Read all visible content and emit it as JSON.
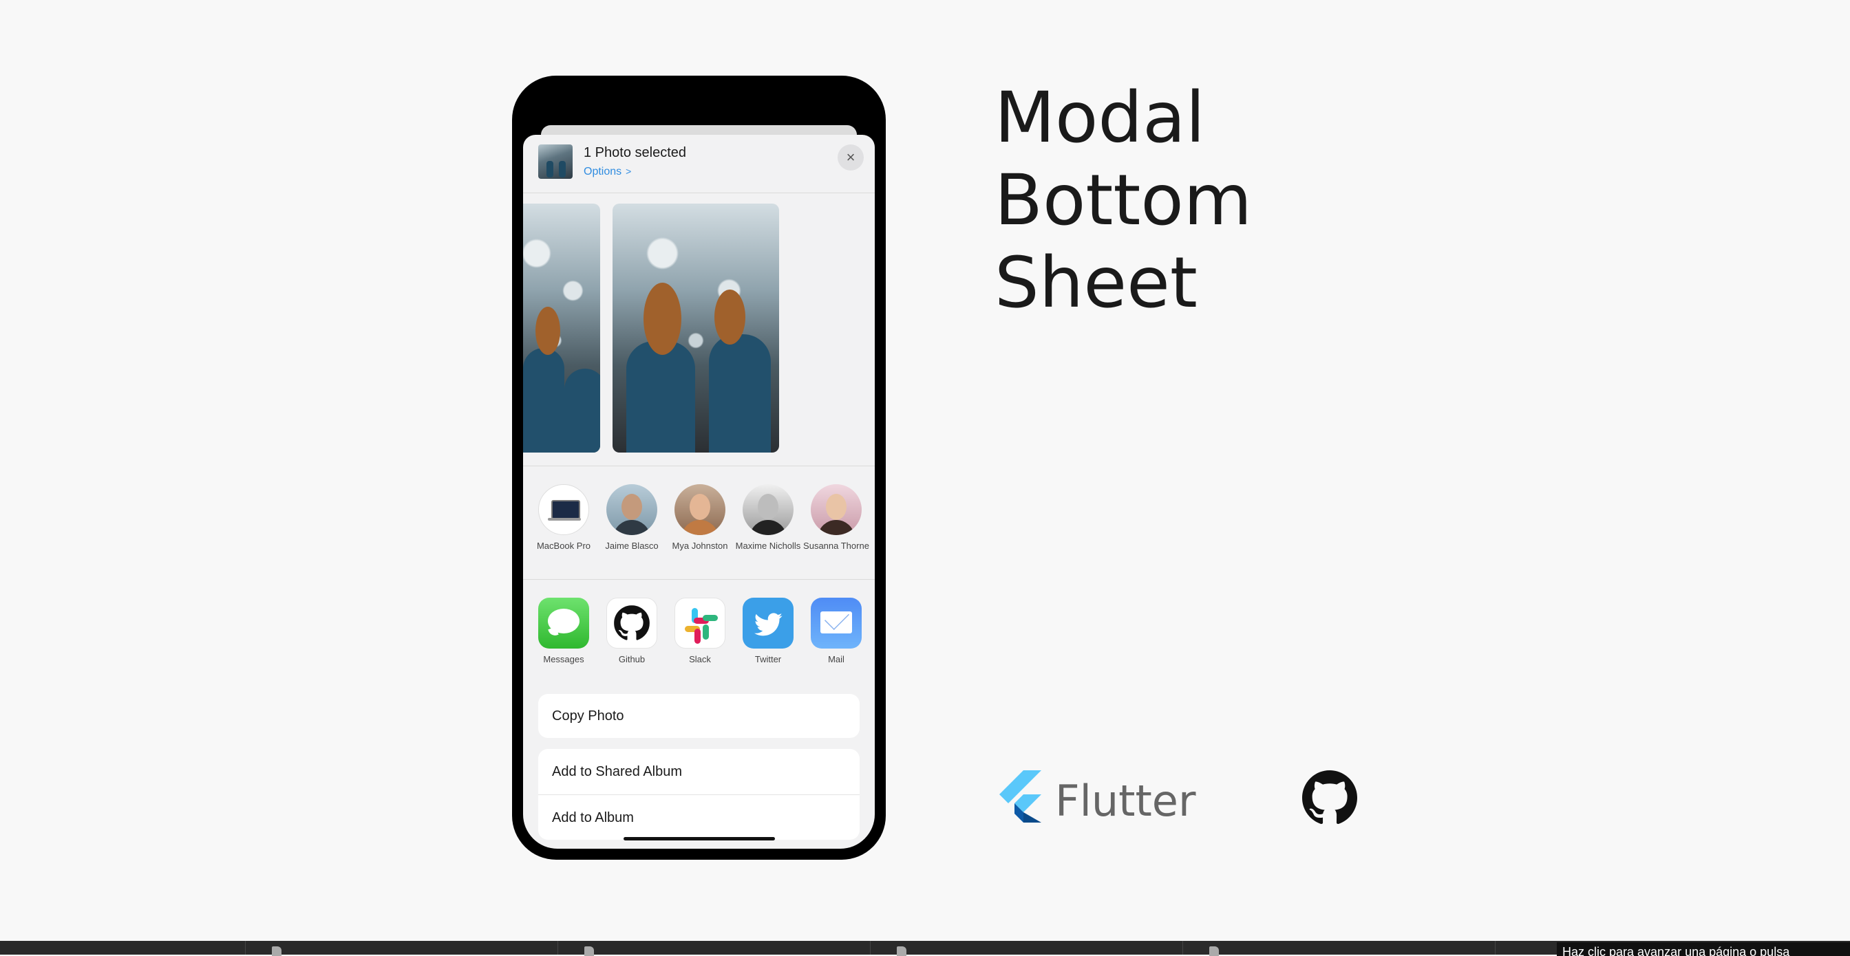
{
  "sheet": {
    "title": "1 Photo selected",
    "options_label": "Options",
    "close_icon": "×"
  },
  "contacts": [
    {
      "name": "MacBook Pro"
    },
    {
      "name": "Jaime Blasco"
    },
    {
      "name": "Mya Johnston"
    },
    {
      "name": "Maxime Nicholls"
    },
    {
      "name": "Susanna Thorne"
    }
  ],
  "apps": [
    {
      "name": "Messages"
    },
    {
      "name": "Github"
    },
    {
      "name": "Slack"
    },
    {
      "name": "Twitter"
    },
    {
      "name": "Mail"
    }
  ],
  "actions": {
    "copy": "Copy Photo",
    "shared_album": "Add to Shared Album",
    "album": "Add to Album"
  },
  "page": {
    "title_line1": "Modal",
    "title_line2": "Bottom",
    "title_line3": "Sheet",
    "flutter_label": "Flutter"
  },
  "taskbar": {
    "tooltip": "Haz clic para avanzar una página o pulsa"
  },
  "colors": {
    "background": "#f8f8f8",
    "link": "#2f8ce0",
    "twitter": "#3b9fe8",
    "flutter_light": "#5ac8fa",
    "flutter_dark": "#0d5aa7"
  }
}
